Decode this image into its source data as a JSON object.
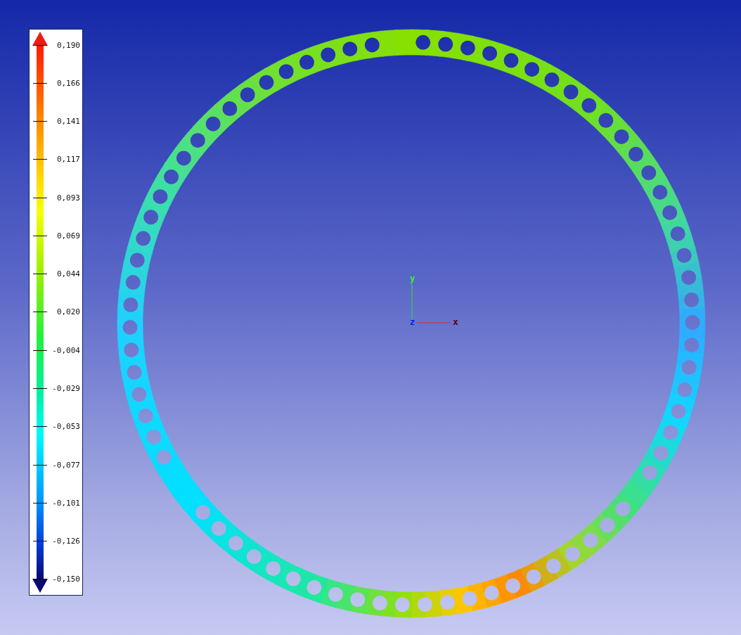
{
  "legend": {
    "scale_labels": [
      "0,190",
      "0,166",
      "0,141",
      "0,117",
      "0,093",
      "0,069",
      "0,044",
      "0,020",
      "-0,004",
      "-0,029",
      "-0,053",
      "-0,077",
      "-0,101",
      "-0,126",
      "-0,150"
    ]
  },
  "axes": {
    "x": "x",
    "y": "y",
    "z": "z"
  }
}
